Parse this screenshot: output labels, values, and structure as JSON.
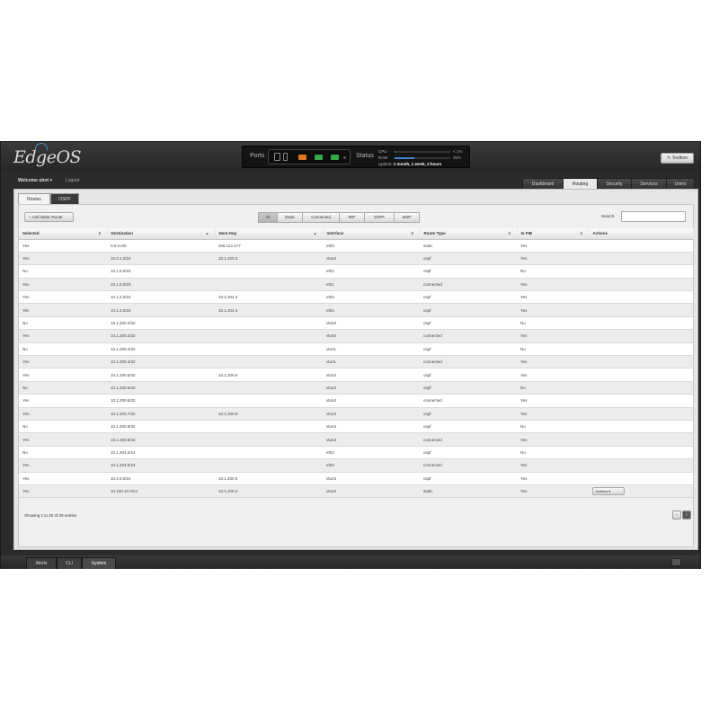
{
  "header": {
    "logo": "EdgeOS",
    "ports_label": "Ports",
    "status_label": "Status",
    "cpu_label": "CPU",
    "cpu_value": "< 1%",
    "cpu_percent": 1,
    "ram_label": "RAM",
    "ram_value": "35%",
    "ram_percent": 35,
    "uptime_label": "Uptime:",
    "uptime_value": "1 month, 1 week, 3 hours",
    "toolbox_label": "✎ Toolbox"
  },
  "userbar": {
    "welcome": "Welcome ubnt",
    "logout": "Logout"
  },
  "nav_tabs": [
    "Dashboard",
    "Routing",
    "Security",
    "Services",
    "Users"
  ],
  "active_nav": "Routing",
  "sub_tabs": [
    "Routes",
    "OSPF"
  ],
  "active_sub_tab": "Routes",
  "toolbar": {
    "add_button": "+ Add Static Route",
    "filters": [
      "All",
      "Static",
      "Connected",
      "RIP",
      "OSPF",
      "BGP"
    ],
    "active_filter": "All",
    "search_label": "Search",
    "search_value": ""
  },
  "table": {
    "columns": [
      "Selected",
      "Destination",
      "Next Hop",
      "Interface",
      "Route Type",
      "In FIB",
      "Actions"
    ],
    "rows": [
      [
        "Yes",
        "0.0.0.0/0",
        "208.113.177",
        "eth0",
        "static",
        "Yes",
        ""
      ],
      [
        "Yes",
        "10.0.1.0/24",
        "10.1.200.3",
        "vtun2",
        "ospf",
        "Yes",
        ""
      ],
      [
        "No",
        "10.1.0.0/23",
        "",
        "eth1",
        "ospf",
        "No",
        ""
      ],
      [
        "Yes",
        "10.1.0.0/23",
        "",
        "eth1",
        "connected",
        "Yes",
        ""
      ],
      [
        "Yes",
        "10.1.2.0/24",
        "10.1.204.2",
        "eth2",
        "ospf",
        "Yes",
        ""
      ],
      [
        "Yes",
        "10.1.3.0/24",
        "10.1.204.3",
        "eth2",
        "ospf",
        "Yes",
        ""
      ],
      [
        "No",
        "10.1.200.2/32",
        "",
        "vtun0",
        "ospf",
        "No",
        ""
      ],
      [
        "Yes",
        "10.1.200.2/32",
        "",
        "vtun0",
        "connected",
        "Yes",
        ""
      ],
      [
        "No",
        "10.1.200.4/32",
        "",
        "vtun1",
        "ospf",
        "No",
        ""
      ],
      [
        "Yes",
        "10.1.200.4/32",
        "",
        "vtun1",
        "connected",
        "Yes",
        ""
      ],
      [
        "Yes",
        "10.1.200.5/32",
        "10.1.200.6",
        "vtun2",
        "ospf",
        "Yes",
        ""
      ],
      [
        "No",
        "10.1.200.6/32",
        "",
        "vtun2",
        "ospf",
        "No",
        ""
      ],
      [
        "Yes",
        "10.1.200.6/32",
        "",
        "vtun2",
        "connected",
        "Yes",
        ""
      ],
      [
        "Yes",
        "10.1.200.7/32",
        "10.1.200.8",
        "vtun3",
        "ospf",
        "Yes",
        ""
      ],
      [
        "No",
        "10.1.200.8/32",
        "",
        "vtun3",
        "ospf",
        "No",
        ""
      ],
      [
        "Yes",
        "10.1.200.8/32",
        "",
        "vtun3",
        "connected",
        "Yes",
        ""
      ],
      [
        "No",
        "10.1.204.0/24",
        "",
        "eth2",
        "ospf",
        "No",
        ""
      ],
      [
        "Yes",
        "10.1.204.0/24",
        "",
        "eth2",
        "connected",
        "Yes",
        ""
      ],
      [
        "Yes",
        "10.2.9.0/24",
        "10.1.200.8",
        "vtun3",
        "ospf",
        "Yes",
        ""
      ],
      [
        "Yes",
        "10.100.10.0/24",
        "10.1.200.2",
        "vtun0",
        "static",
        "Yes",
        "Actions ▾"
      ]
    ]
  },
  "paging": {
    "info": "Showing 1 to 20 of 29 entries",
    "prev": "‹",
    "next": "›"
  },
  "bottom_tabs": [
    "Alerts",
    "CLI",
    "System"
  ],
  "active_bottom_tab": "System",
  "colors": {
    "port_active": "#e0771c",
    "port_green": "#3aa64a",
    "meter": "#3f85c7"
  }
}
